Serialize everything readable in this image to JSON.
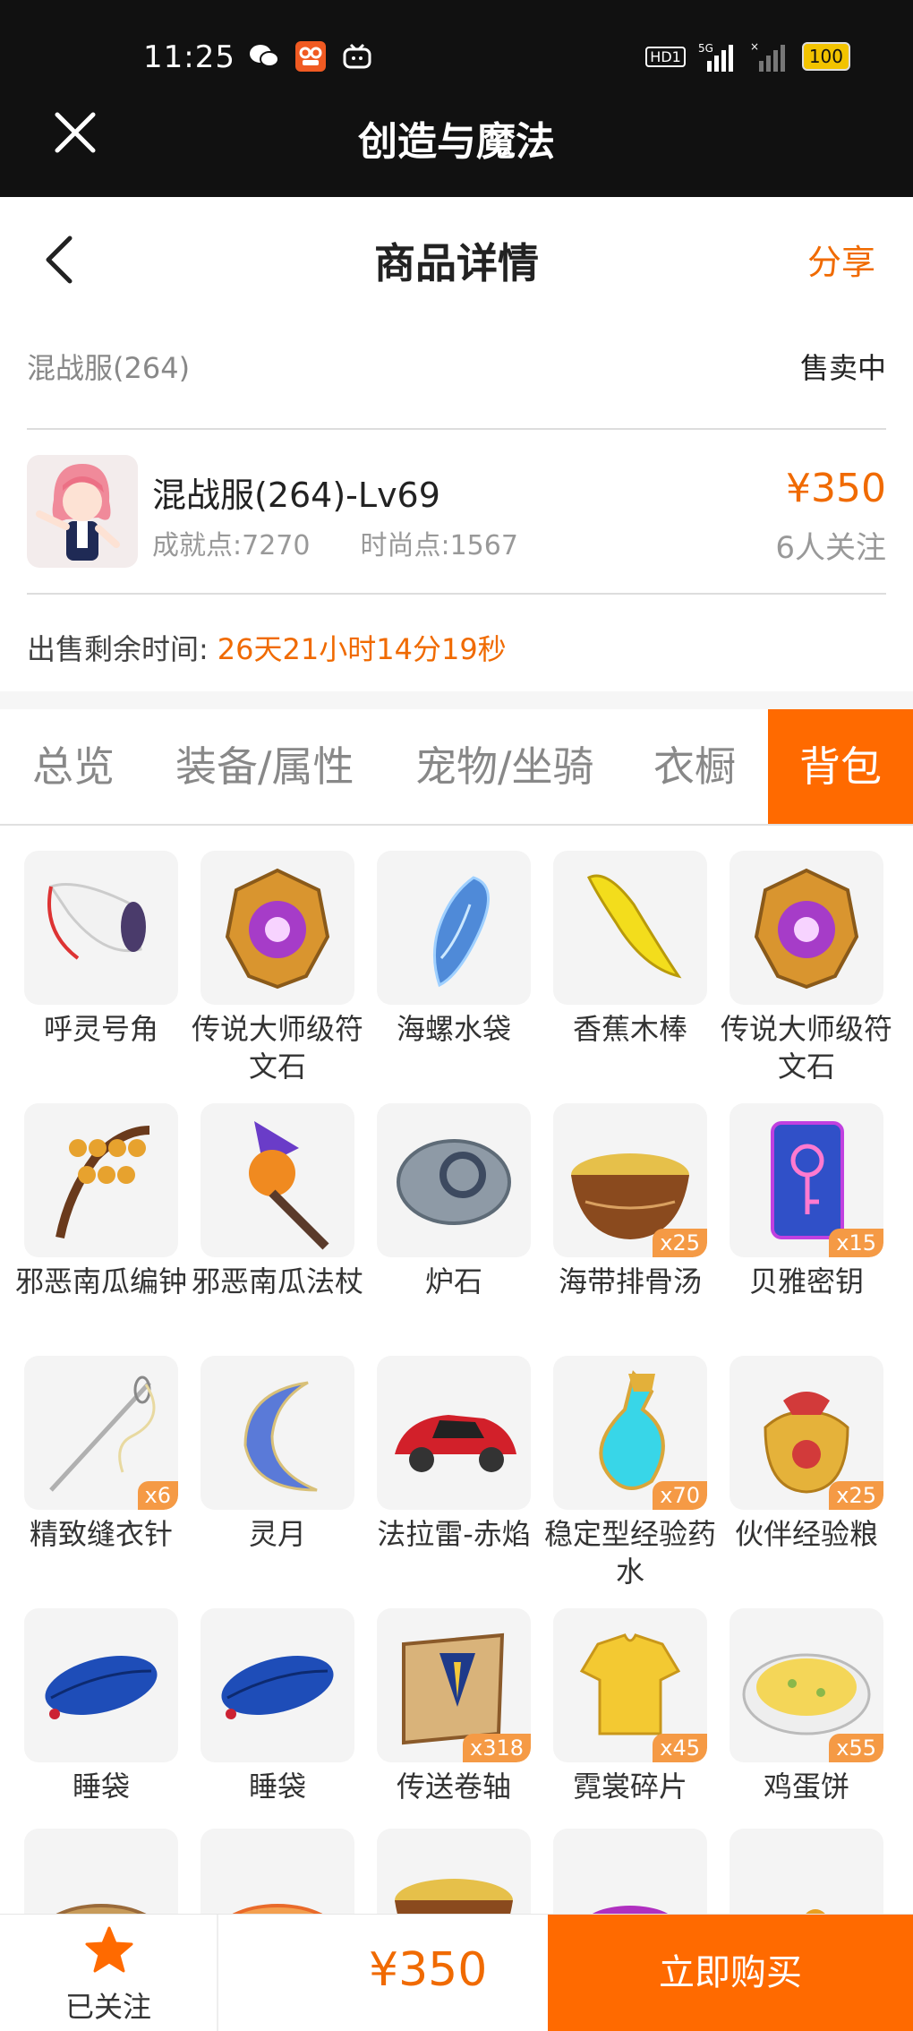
{
  "status_bar": {
    "time": "11:25",
    "signal_label": "5G",
    "hd_label": "HD1",
    "battery": "100"
  },
  "title_bar": {
    "title": "创造与魔法"
  },
  "nav": {
    "title": "商品详情",
    "share": "分享"
  },
  "server": {
    "name": "混战服(264)",
    "state": "售卖中"
  },
  "product": {
    "name": "混战服(264)-Lv69",
    "achievement": "成就点:7270",
    "fashion": "时尚点:1567",
    "price": "¥350",
    "followers": "6人关注"
  },
  "remaining": {
    "label": "出售剩余时间:",
    "value": "26天21小时14分19秒"
  },
  "tabs": [
    {
      "label": "总览",
      "active": false
    },
    {
      "label": "装备/属性",
      "active": false
    },
    {
      "label": "宠物/坐骑",
      "active": false
    },
    {
      "label": "衣橱",
      "active": false
    },
    {
      "label": "背包",
      "active": true
    }
  ],
  "items": [
    {
      "name": "呼灵号角",
      "qty": "",
      "icon": "horn-icon"
    },
    {
      "name": "传说大师级符文石",
      "qty": "",
      "icon": "rune-stone-icon"
    },
    {
      "name": "海螺水袋",
      "qty": "",
      "icon": "conch-icon"
    },
    {
      "name": "香蕉木棒",
      "qty": "",
      "icon": "banana-club-icon"
    },
    {
      "name": "传说大师级符文石",
      "qty": "",
      "icon": "rune-stone-icon"
    },
    {
      "name": "邪恶南瓜编钟",
      "qty": "",
      "icon": "pumpkin-bells-icon"
    },
    {
      "name": "邪恶南瓜法杖",
      "qty": "",
      "icon": "pumpkin-staff-icon"
    },
    {
      "name": "炉石",
      "qty": "",
      "icon": "hearthstone-icon"
    },
    {
      "name": "海带排骨汤",
      "qty": "x25",
      "icon": "soup-icon"
    },
    {
      "name": "贝雅密钥",
      "qty": "x15",
      "icon": "key-card-icon"
    },
    {
      "name": "精致缝衣针",
      "qty": "x6",
      "icon": "needle-icon"
    },
    {
      "name": "灵月",
      "qty": "",
      "icon": "moon-icon"
    },
    {
      "name": "法拉雷-赤焰",
      "qty": "",
      "icon": "red-car-icon"
    },
    {
      "name": "稳定型经验药水",
      "qty": "x70",
      "icon": "potion-icon"
    },
    {
      "name": "伙伴经验粮",
      "qty": "x25",
      "icon": "food-bag-icon"
    },
    {
      "name": "睡袋",
      "qty": "",
      "icon": "sleeping-bag-icon"
    },
    {
      "name": "睡袋",
      "qty": "",
      "icon": "sleeping-bag-icon"
    },
    {
      "name": "传送卷轴",
      "qty": "x318",
      "icon": "scroll-icon"
    },
    {
      "name": "霓裳碎片",
      "qty": "x45",
      "icon": "shirt-icon"
    },
    {
      "name": "鸡蛋饼",
      "qty": "x55",
      "icon": "omelette-icon"
    },
    {
      "name": "",
      "qty": "",
      "icon": "fish-dish-icon"
    },
    {
      "name": "",
      "qty": "",
      "icon": "stew-icon"
    },
    {
      "name": "",
      "qty": "",
      "icon": "soup-icon"
    },
    {
      "name": "",
      "qty": "",
      "icon": "purple-drink-icon"
    },
    {
      "name": "",
      "qty": "",
      "icon": "fruit-plate-icon"
    }
  ],
  "bottom": {
    "follow_label": "已关注",
    "price": "¥350",
    "buy_label": "立即购买"
  },
  "colors": {
    "accent": "#ff6a00",
    "price": "#f06a00",
    "dark_bar": "#111111"
  }
}
